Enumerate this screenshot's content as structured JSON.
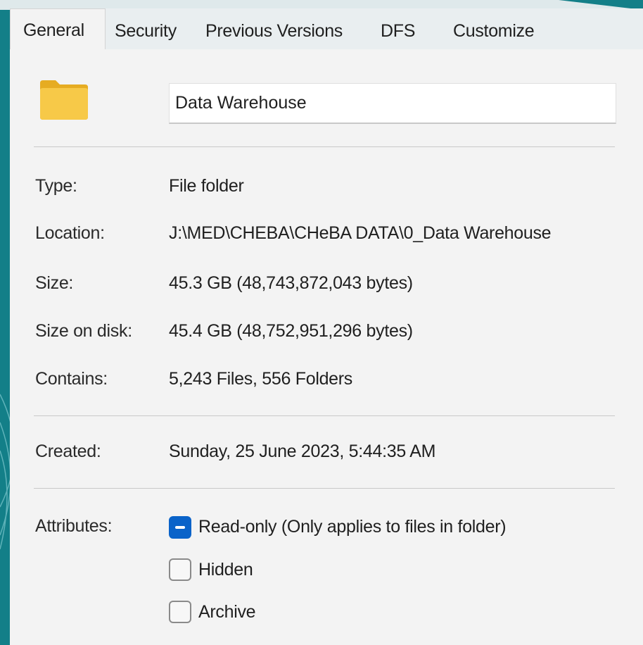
{
  "tabs": [
    {
      "label": "General",
      "active": true
    },
    {
      "label": "Security",
      "active": false
    },
    {
      "label": "Previous Versions",
      "active": false
    },
    {
      "label": "DFS",
      "active": false
    },
    {
      "label": "Customize",
      "active": false
    }
  ],
  "header": {
    "icon": "folder-icon",
    "folder_name": "Data Warehouse"
  },
  "details": {
    "type": {
      "label": "Type:",
      "value": "File folder"
    },
    "location": {
      "label": "Location:",
      "value": "J:\\MED\\CHEBA\\CHeBA DATA\\0_Data Warehouse"
    },
    "size": {
      "label": "Size:",
      "value": "45.3 GB (48,743,872,043 bytes)"
    },
    "size_on_disk": {
      "label": "Size on disk:",
      "value": "45.4 GB (48,752,951,296 bytes)"
    },
    "contains": {
      "label": "Contains:",
      "value": "5,243 Files, 556 Folders"
    }
  },
  "created": {
    "label": "Created:",
    "value": "Sunday, 25 June 2023, 5:44:35 AM"
  },
  "attributes": {
    "label": "Attributes:",
    "options": [
      {
        "label": "Read-only (Only applies to files in folder)",
        "state": "indeterminate"
      },
      {
        "label": "Hidden",
        "state": "unchecked"
      },
      {
        "label": "Archive",
        "state": "unchecked"
      }
    ]
  },
  "colors": {
    "background": "#137f88",
    "panel": "#f3f3f3",
    "accent": "#0a63c9",
    "folder": "#f7c948"
  }
}
